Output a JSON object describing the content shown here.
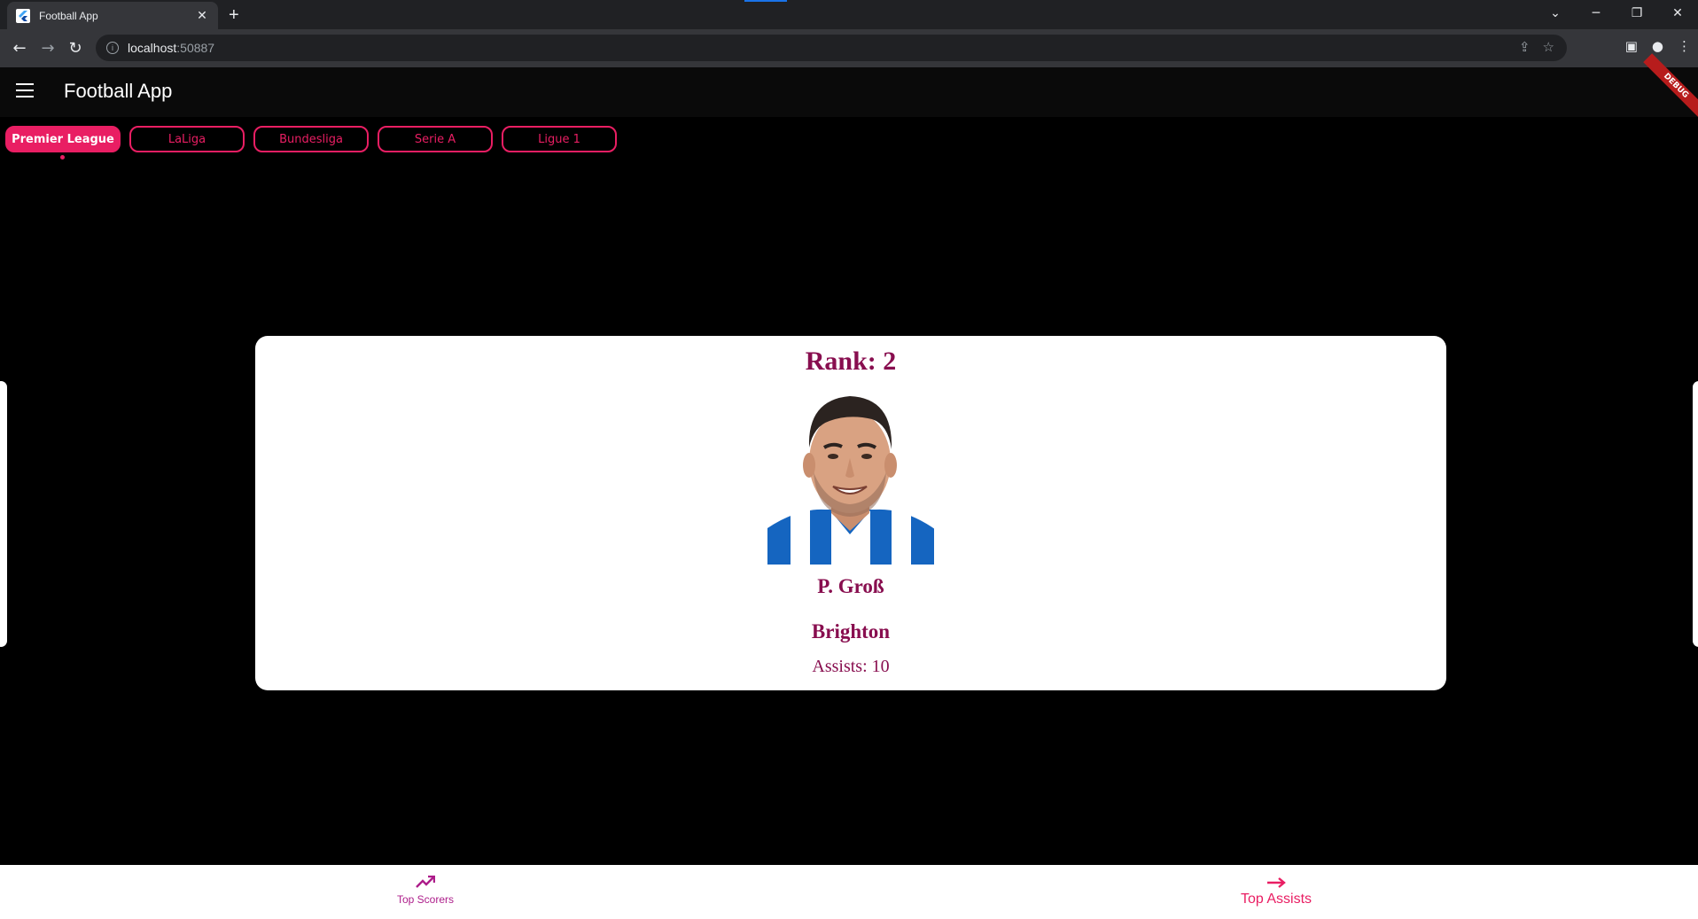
{
  "browser": {
    "tab_title": "Football App",
    "tab_close": "✕",
    "new_tab": "+",
    "url_host": "localhost",
    "url_port": ":50887",
    "window": {
      "dropdown": "⌄",
      "minimize": "─",
      "restore": "❐",
      "close": "✕"
    }
  },
  "app": {
    "title": "Football App",
    "debug_label": "DEBUG"
  },
  "leagues": {
    "items": [
      "Premier League",
      "LaLiga",
      "Bundesliga",
      "Serie A",
      "Ligue 1"
    ],
    "selected": "Premier League"
  },
  "player_card": {
    "rank": "Rank: 2",
    "name": "P. Groß",
    "team": "Brighton",
    "assists": "Assists: 10"
  },
  "bottom_nav": {
    "scorers_label": "Top Scorers",
    "assists_label": "Top Assists",
    "selected": "Top Assists"
  },
  "icons": {
    "menu": "menu-icon",
    "scorers": "trending-up-icon",
    "assists": "arrow-right-icon"
  },
  "colors": {
    "accent": "#e91e63",
    "text_primary": "#880e4f",
    "background": "#000000"
  }
}
